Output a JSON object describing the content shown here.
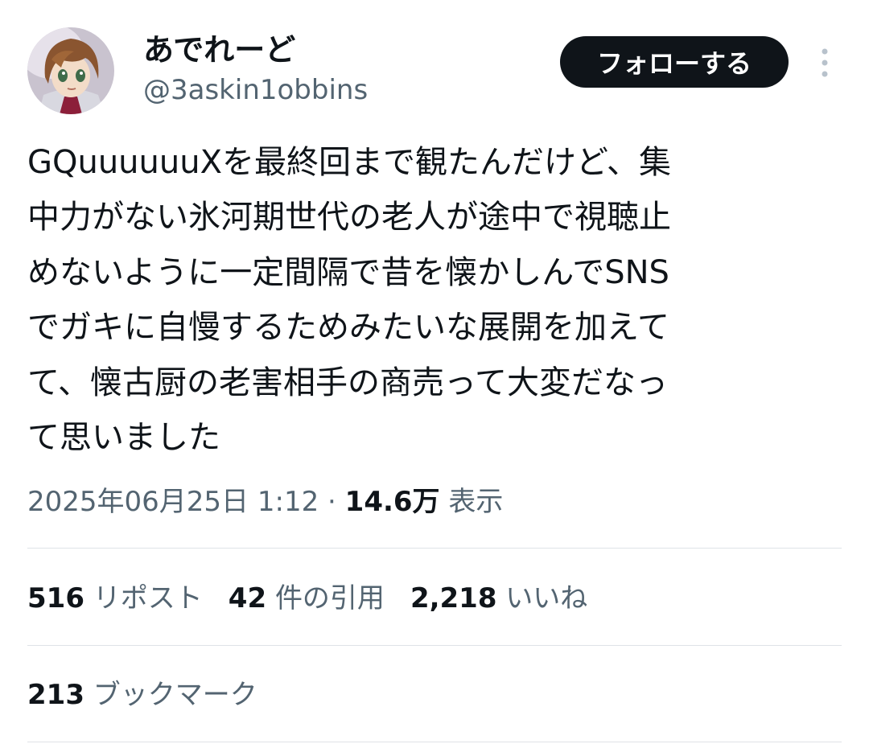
{
  "user": {
    "display_name": "あでれーど",
    "handle": "@3askin1obbins",
    "avatar": "anime-character-avatar"
  },
  "follow_button": {
    "label": "フォローする"
  },
  "more_icon": "vertical-ellipsis-icon",
  "tweet": {
    "lines": [
      "GQuuuuuuXを最終回まで観たんだけど、集",
      "中力がない氷河期世代の老人が途中で視聴止",
      "めないように一定間隔で昔を懐かしんでSNS",
      "でガキに自慢するためみたいな展開を加えて",
      "て、懐古厨の老害相手の商売って大変だなっ",
      "て思いました"
    ]
  },
  "meta": {
    "timestamp": "2025年06月25日 1:12",
    "separator": " · ",
    "views_count": "14.6万",
    "views_label": "表示"
  },
  "stats": {
    "reposts_count": "516",
    "reposts_label": "リポスト",
    "quotes_count": "42",
    "quotes_label": "件の引用",
    "likes_count": "2,218",
    "likes_label": "いいね",
    "bookmarks_count": "213",
    "bookmarks_label": "ブックマーク"
  },
  "colors": {
    "text_primary": "#0f1419",
    "text_secondary": "#536471",
    "divider": "#dfe3e7",
    "follow_bg": "#0f1419",
    "follow_text": "#ffffff"
  }
}
